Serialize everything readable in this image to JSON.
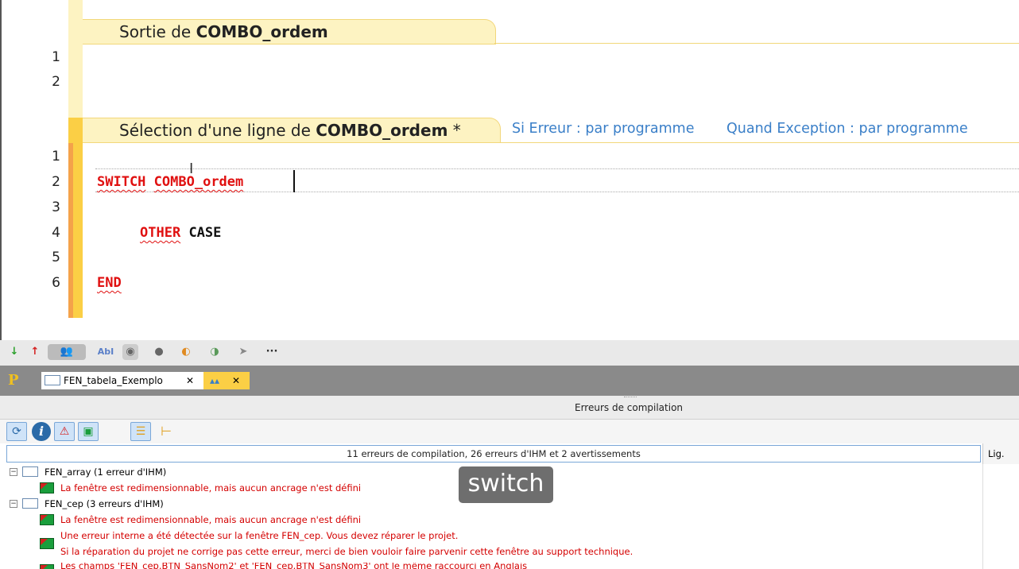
{
  "editor": {
    "section_exit": {
      "prefix": "Sortie de ",
      "control": "COMBO_ordem",
      "lines": [
        "1",
        "2"
      ]
    },
    "section_select": {
      "prefix": "Sélection d'une ligne de ",
      "control": "COMBO_ordem",
      "modified_mark": " *",
      "error_mode": "Si Erreur : par programme",
      "exception_mode": "Quand Exception : par programme",
      "lines": [
        "1",
        "2",
        "3",
        "4",
        "5",
        "6"
      ],
      "code": {
        "switch_kw": "SWITCH",
        "switch_arg": "COMBO_ordem",
        "other_kw": "OTHER",
        "case_kw": "CASE",
        "end_kw": "END"
      }
    }
  },
  "toolbar": {
    "more": "···"
  },
  "tabs": {
    "project_icon": "P",
    "doc_tab_label": "FEN_tabela_Exemplo",
    "close": "✕"
  },
  "panel": {
    "title": "Erreurs de compilation",
    "summary": "11 erreurs de compilation, 26 erreurs d'IHM et 2 avertissements",
    "lig_header": "Lig.",
    "items": [
      {
        "kind": "group",
        "label": "FEN_array (1 erreur d'IHM)"
      },
      {
        "kind": "error",
        "text": "La fenêtre est redimensionnable, mais aucun ancrage n'est défini"
      },
      {
        "kind": "group",
        "label": "FEN_cep (3 erreurs d'IHM)"
      },
      {
        "kind": "error",
        "text": "La fenêtre est redimensionnable, mais aucun ancrage n'est défini"
      },
      {
        "kind": "error2",
        "text": "Une erreur interne a été détectée sur la fenêtre FEN_cep. Vous devez réparer le projet.",
        "text2": "Si la réparation du projet ne corrige pas cette erreur, merci de bien vouloir faire parvenir cette fenêtre au support technique."
      },
      {
        "kind": "error",
        "text": "Les champs 'FEN_cep.BTN_SansNom2' et 'FEN_cep.BTN_SansNom3' ont le même raccourci en Anglais"
      }
    ]
  },
  "tooltip": {
    "text": "switch"
  },
  "colors": {
    "keyword": "#e01010",
    "link": "#3a7fc8",
    "section_bg": "#fdf3c2",
    "gutter_active": "#fbcf45"
  }
}
